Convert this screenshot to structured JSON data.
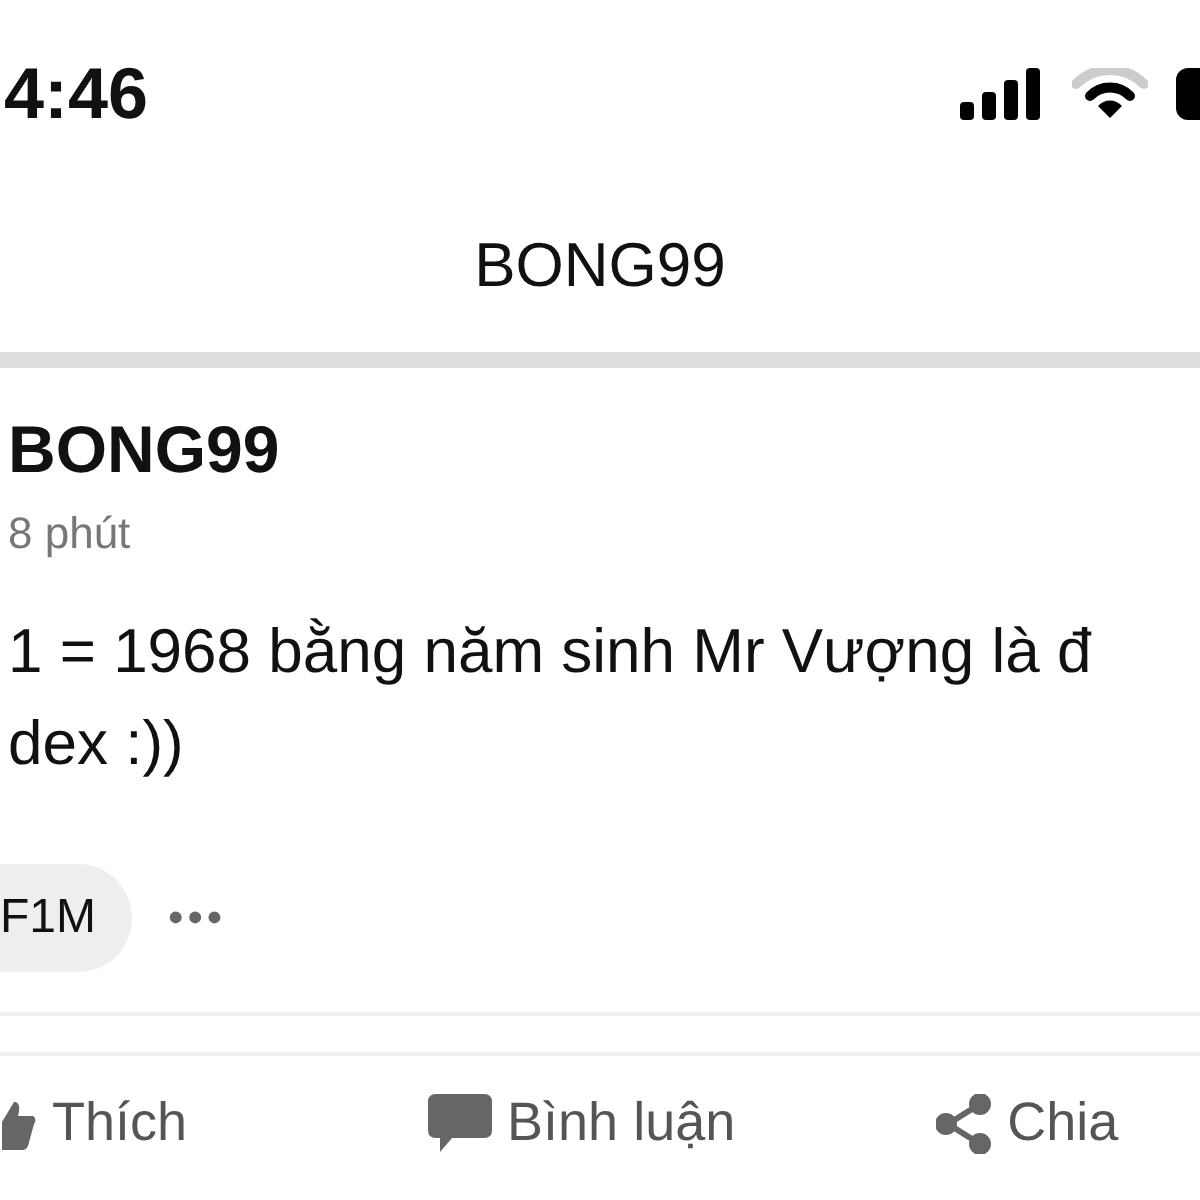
{
  "status_bar": {
    "time": "4:46"
  },
  "nav": {
    "title": "BONG99"
  },
  "post": {
    "author": "BONG99",
    "time": "8 phút",
    "lines": [
      "1 = 1968 bằng năm sinh Mr Vượng là đ",
      "dex :))"
    ],
    "tag": "F1M",
    "more": "•••"
  },
  "actions": [
    {
      "kind": "like",
      "label": "Thích"
    },
    {
      "kind": "comment",
      "label": "Bình luận"
    },
    {
      "kind": "share",
      "label": "Chia"
    }
  ]
}
